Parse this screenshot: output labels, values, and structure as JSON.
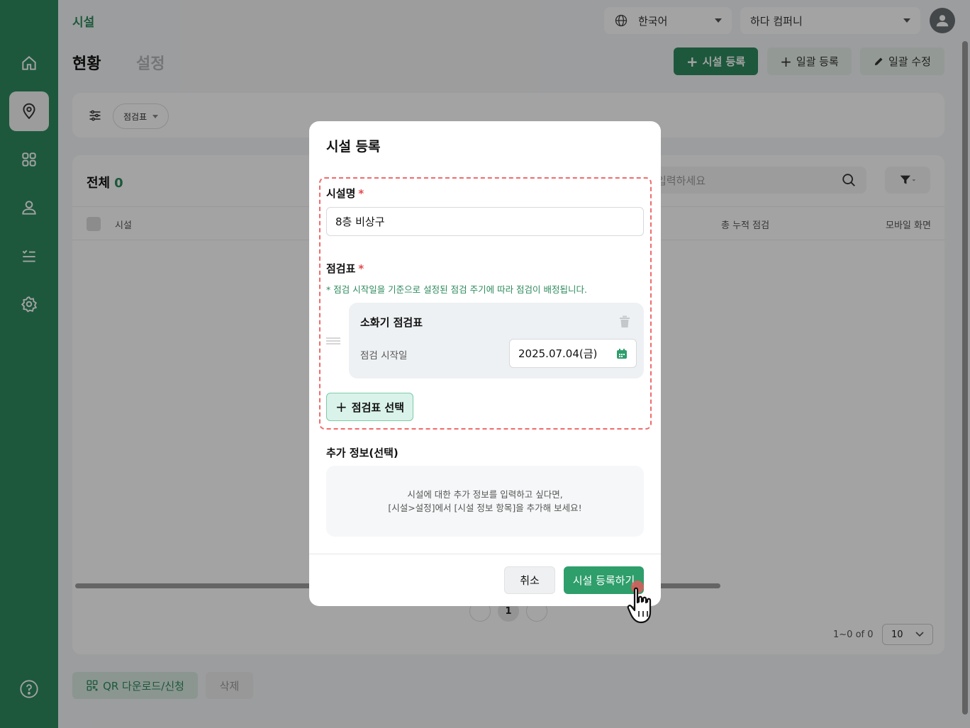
{
  "header": {
    "breadcrumb": "시설",
    "language": "한국어",
    "company": "하다 컴퍼니"
  },
  "tabs": {
    "current": "현황",
    "settings": "설정"
  },
  "actions": {
    "register": "시설 등록",
    "bulk_register": "일괄 등록",
    "bulk_edit": "일괄 수정"
  },
  "filters": {
    "chip": "점검표"
  },
  "list": {
    "total_label": "전체",
    "total_count": "0",
    "search_placeholder": "입력하세요",
    "columns": [
      "시설",
      "총 누적 점검",
      "모바일 화면"
    ],
    "page": "1",
    "range": "1~0 of 0",
    "page_size": "10"
  },
  "bottom": {
    "qr": "QR 다운로드/신청",
    "delete": "삭제"
  },
  "modal": {
    "title": "시설 등록",
    "name_label": "시설명",
    "required_mark": "*",
    "name_value": "8층 비상구",
    "checklist_label": "점검표",
    "hint": "* 점검 시작일을 기준으로 설정된 점검 주기에 따라 점검이 배정됩니다.",
    "checklist_item": {
      "name": "소화기 점검표",
      "start_label": "점검 시작일",
      "start_date": "2025.07.04(금)"
    },
    "select_checklist": "점검표 선택",
    "extra_label": "추가 정보(선택)",
    "extra_line1": "시설에 대한 추가 정보를 입력하고 싶다면,",
    "extra_line2": "[시설>설정]에서 [시설 정보 항목]을 추가해 보세요!",
    "cancel": "취소",
    "submit": "시설 등록하기"
  },
  "colors": {
    "brand": "#2e8a5e",
    "required": "#e5484d",
    "dashed": "#ef6b6b"
  }
}
